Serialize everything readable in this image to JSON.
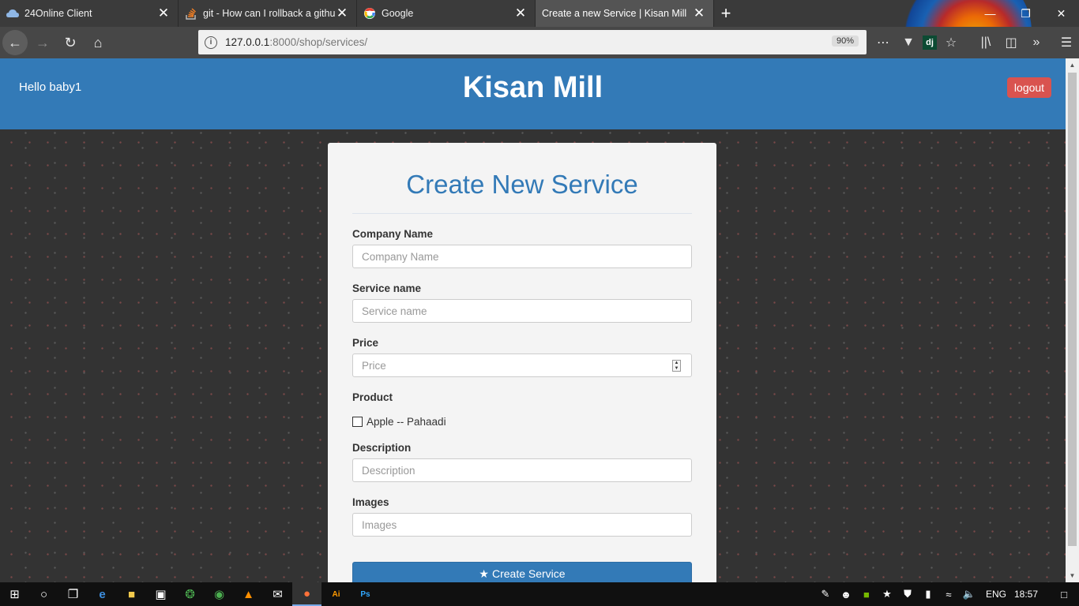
{
  "browser": {
    "tabs": [
      {
        "title": "24Online Client",
        "active": false,
        "icon": "cloud-icon"
      },
      {
        "title": "git - How can I rollback a githu",
        "active": false,
        "icon": "stackoverflow-icon"
      },
      {
        "title": "Google",
        "active": false,
        "icon": "google-icon"
      },
      {
        "title": "Create a new Service | Kisan Mill",
        "active": true,
        "icon": "none"
      }
    ],
    "url_host": "127.0.0.1",
    "url_path": ":8000/shop/services/",
    "zoom": "90%"
  },
  "site": {
    "greeting": "Hello baby1",
    "brand": "Kisan Mill",
    "logout_label": "logout"
  },
  "form": {
    "heading": "Create New Service",
    "company_label": "Company Name",
    "company_placeholder": "Company Name",
    "service_label": "Service name",
    "service_placeholder": "Service name",
    "price_label": "Price",
    "price_placeholder": "Price",
    "product_label": "Product",
    "product_option": "Apple -- Pahaadi",
    "description_label": "Description",
    "description_placeholder": "Description",
    "images_label": "Images",
    "images_placeholder": "Images",
    "submit_label": "Create Service"
  },
  "taskbar": {
    "language": "ENG",
    "time": "18:57"
  },
  "colors": {
    "primary": "#337ab7",
    "danger": "#d9534f",
    "page_bg": "#333333"
  }
}
